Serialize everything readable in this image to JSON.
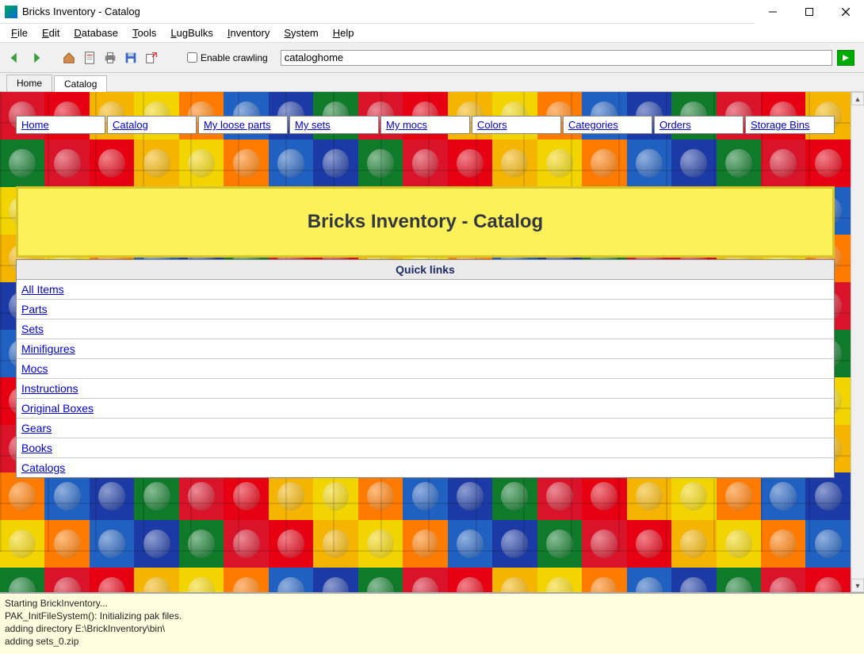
{
  "window": {
    "title": "Bricks Inventory - Catalog"
  },
  "menu": {
    "file": "File",
    "edit": "Edit",
    "database": "Database",
    "tools": "Tools",
    "lugbulks": "LugBulks",
    "inventory": "Inventory",
    "system": "System",
    "help": "Help"
  },
  "toolbar": {
    "enable_crawling": "Enable crawling",
    "address": "cataloghome"
  },
  "tabs": {
    "items": [
      "Home",
      "Catalog"
    ],
    "active": 1
  },
  "nav": {
    "items": [
      "Home",
      "Catalog",
      "My loose parts",
      "My sets",
      "My mocs",
      "Colors",
      "Categories",
      "Orders",
      "Storage Bins"
    ]
  },
  "page_title": "Bricks Inventory - Catalog",
  "quicklinks": {
    "header": "Quick links",
    "items": [
      "All Items",
      "Parts",
      "Sets",
      "Minifigures",
      "Mocs",
      "Instructions",
      "Original Boxes",
      "Gears",
      "Books",
      "Catalogs"
    ]
  },
  "log": {
    "lines": [
      "Starting BrickInventory...",
      "PAK_InitFileSystem(): Initializing pak files.",
      "adding directory E:\\BrickInventory\\bin\\",
      "adding sets_0.zip"
    ]
  },
  "brick_colors": [
    "#d9142a",
    "#2060c0",
    "#f5b400",
    "#0f7a2a",
    "#ff7b00",
    "#e60012",
    "#1b3aa5",
    "#f2d500"
  ]
}
